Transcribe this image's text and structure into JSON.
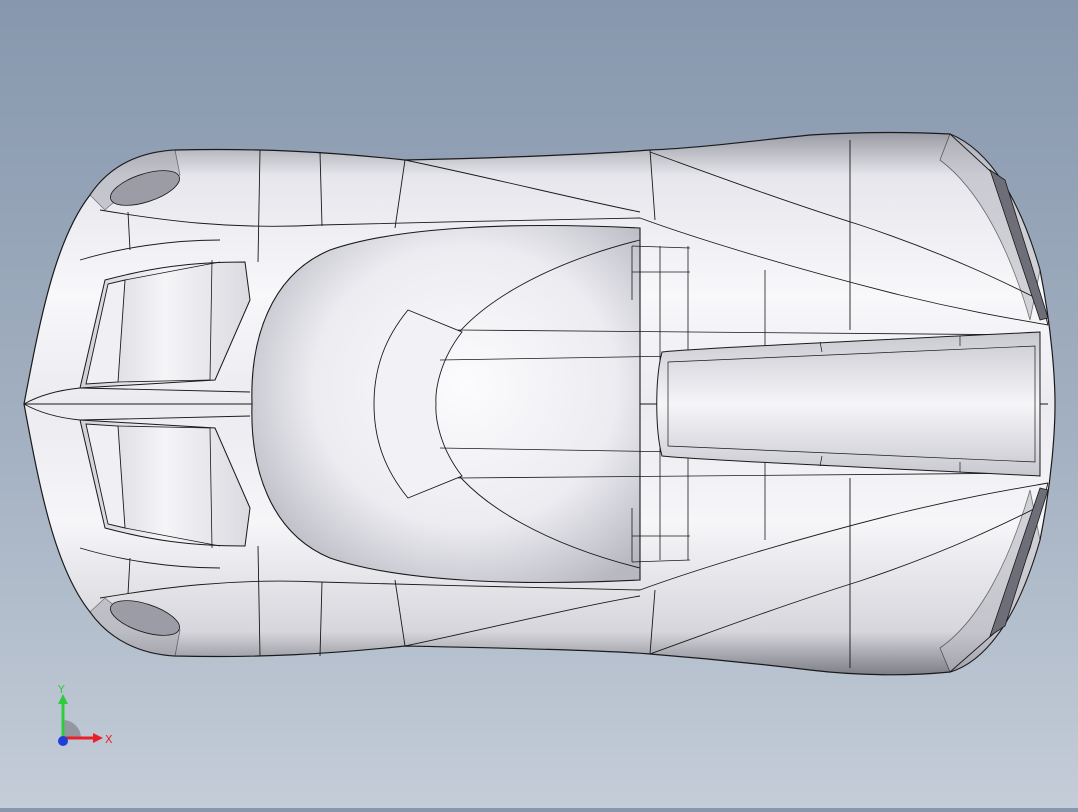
{
  "viewport": {
    "model": "car-body-top-view",
    "colors": {
      "background_top": "#8797ad",
      "background_bottom": "#c4cdd8",
      "body_light": "#f4f4f8",
      "body_shade": "#8c8c96",
      "edge": "#1a1a1a"
    }
  },
  "triad": {
    "y_label": "Y",
    "x_label": "X",
    "colors": {
      "y": "#2ecc40",
      "x": "#e8202a",
      "z": "#1f3fd8"
    }
  }
}
